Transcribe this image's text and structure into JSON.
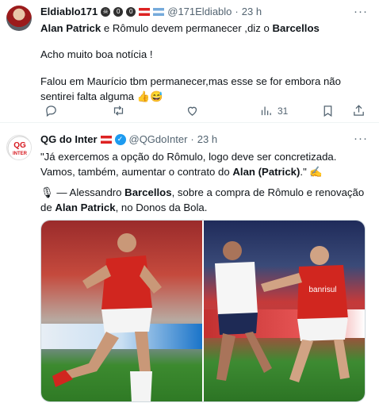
{
  "tweets": [
    {
      "display_name": "Eldiablo171",
      "badges": [
        "☠",
        "0",
        "0"
      ],
      "handle": "@171Eldiablo",
      "separator": "·",
      "time": "23 h",
      "text": {
        "line1": {
          "b1": "Alan Patrick",
          "t1": " e Rômulo devem permanecer ,diz o ",
          "b2": "Barcellos"
        },
        "line2": "Acho muito boa notícia !",
        "line3": "Falou em Maurício tbm permanecer,mas esse se for embora não sentirei falta alguma 👍😅"
      },
      "actions": {
        "reply": "",
        "retweet": "",
        "like": "",
        "views": "31",
        "bookmark": "",
        "share": ""
      }
    },
    {
      "display_name": "QG do Inter",
      "handle": "@QGdoInter",
      "separator": "·",
      "time": "23 h",
      "avatar_text": "QG INTER",
      "text": {
        "p1_a": "\"Já exercemos a opção do Rômulo, logo deve ser concretizada. Vamos, também, aumentar o contrato do ",
        "p1_b": "Alan (Patrick)",
        "p1_c": ".\" ✍️",
        "p2_a": "🎙 — Alessandro ",
        "p2_b": "Barcellos",
        "p2_c": ", sobre a compra de Rômulo e renovação de ",
        "p2_d": "Alan Patrick",
        "p2_e": ", no Donos da Bola."
      },
      "media": {
        "photo1_text": "",
        "photo2_text": "banrisul"
      }
    }
  ],
  "colors": {
    "accent": "#1d9bf0",
    "muted": "#536471",
    "text": "#0f1419",
    "divider": "#eff3f4"
  }
}
